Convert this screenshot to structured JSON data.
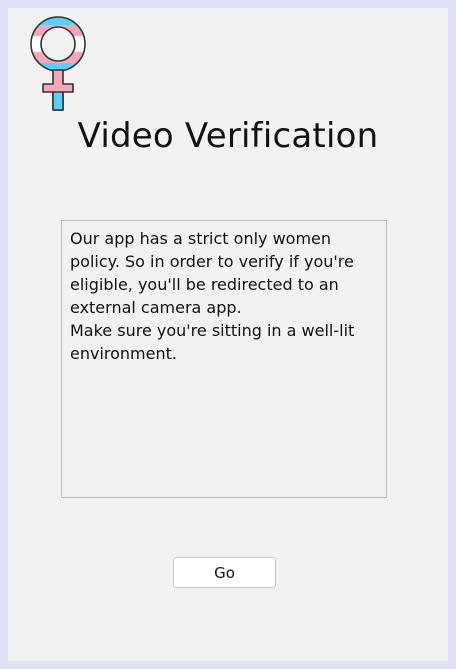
{
  "window": {
    "logo_icon": "female-symbol-icon",
    "title": "Video Verification",
    "message": "Our app has a strict only women\npolicy. So in order to verify if you're\neligible, you'll be redirected to an\nexternal camera app.\nMake sure you're sitting in a well-lit\nenvironment.",
    "go_label": "Go"
  },
  "colors": {
    "outer_frame": "#dfe1f6",
    "panel_bg": "#f2f2f2",
    "logo_pink": "#f5a9b8",
    "logo_blue": "#5bcefa",
    "logo_white": "#ffffff"
  }
}
